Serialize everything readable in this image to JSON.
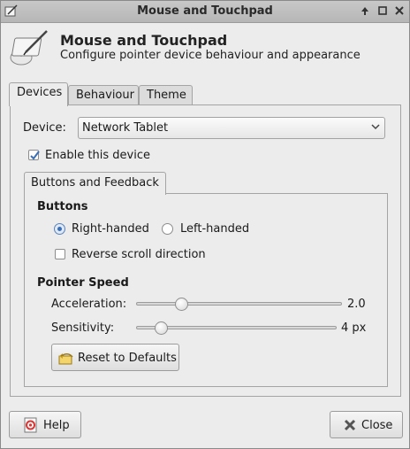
{
  "window": {
    "title": "Mouse and Touchpad",
    "controls": [
      "up-icon",
      "maximize-icon",
      "close-icon"
    ]
  },
  "header": {
    "title": "Mouse and Touchpad",
    "subtitle": "Configure pointer device behaviour and appearance"
  },
  "tabs": [
    {
      "label": "Devices",
      "active": true
    },
    {
      "label": "Behaviour",
      "active": false
    },
    {
      "label": "Theme",
      "active": false
    }
  ],
  "device": {
    "label": "Device:",
    "selected": "Network Tablet",
    "enable_label": "Enable this device",
    "enabled": true
  },
  "inner_tab": {
    "label": "Buttons and Feedback"
  },
  "buttons_section": {
    "title": "Buttons",
    "right_handed": "Right-handed",
    "left_handed": "Left-handed",
    "handedness": "right",
    "reverse_scroll": "Reverse scroll direction",
    "reverse_scroll_checked": false
  },
  "pointer_speed": {
    "title": "Pointer Speed",
    "acceleration_label": "Acceleration:",
    "acceleration_value": "2.0",
    "acceleration_fraction": 0.2,
    "sensitivity_label": "Sensitivity:",
    "sensitivity_value": "4 px",
    "sensitivity_fraction": 0.1,
    "reset_label": "Reset to Defaults"
  },
  "footer": {
    "help_label": "Help",
    "close_label": "Close"
  }
}
